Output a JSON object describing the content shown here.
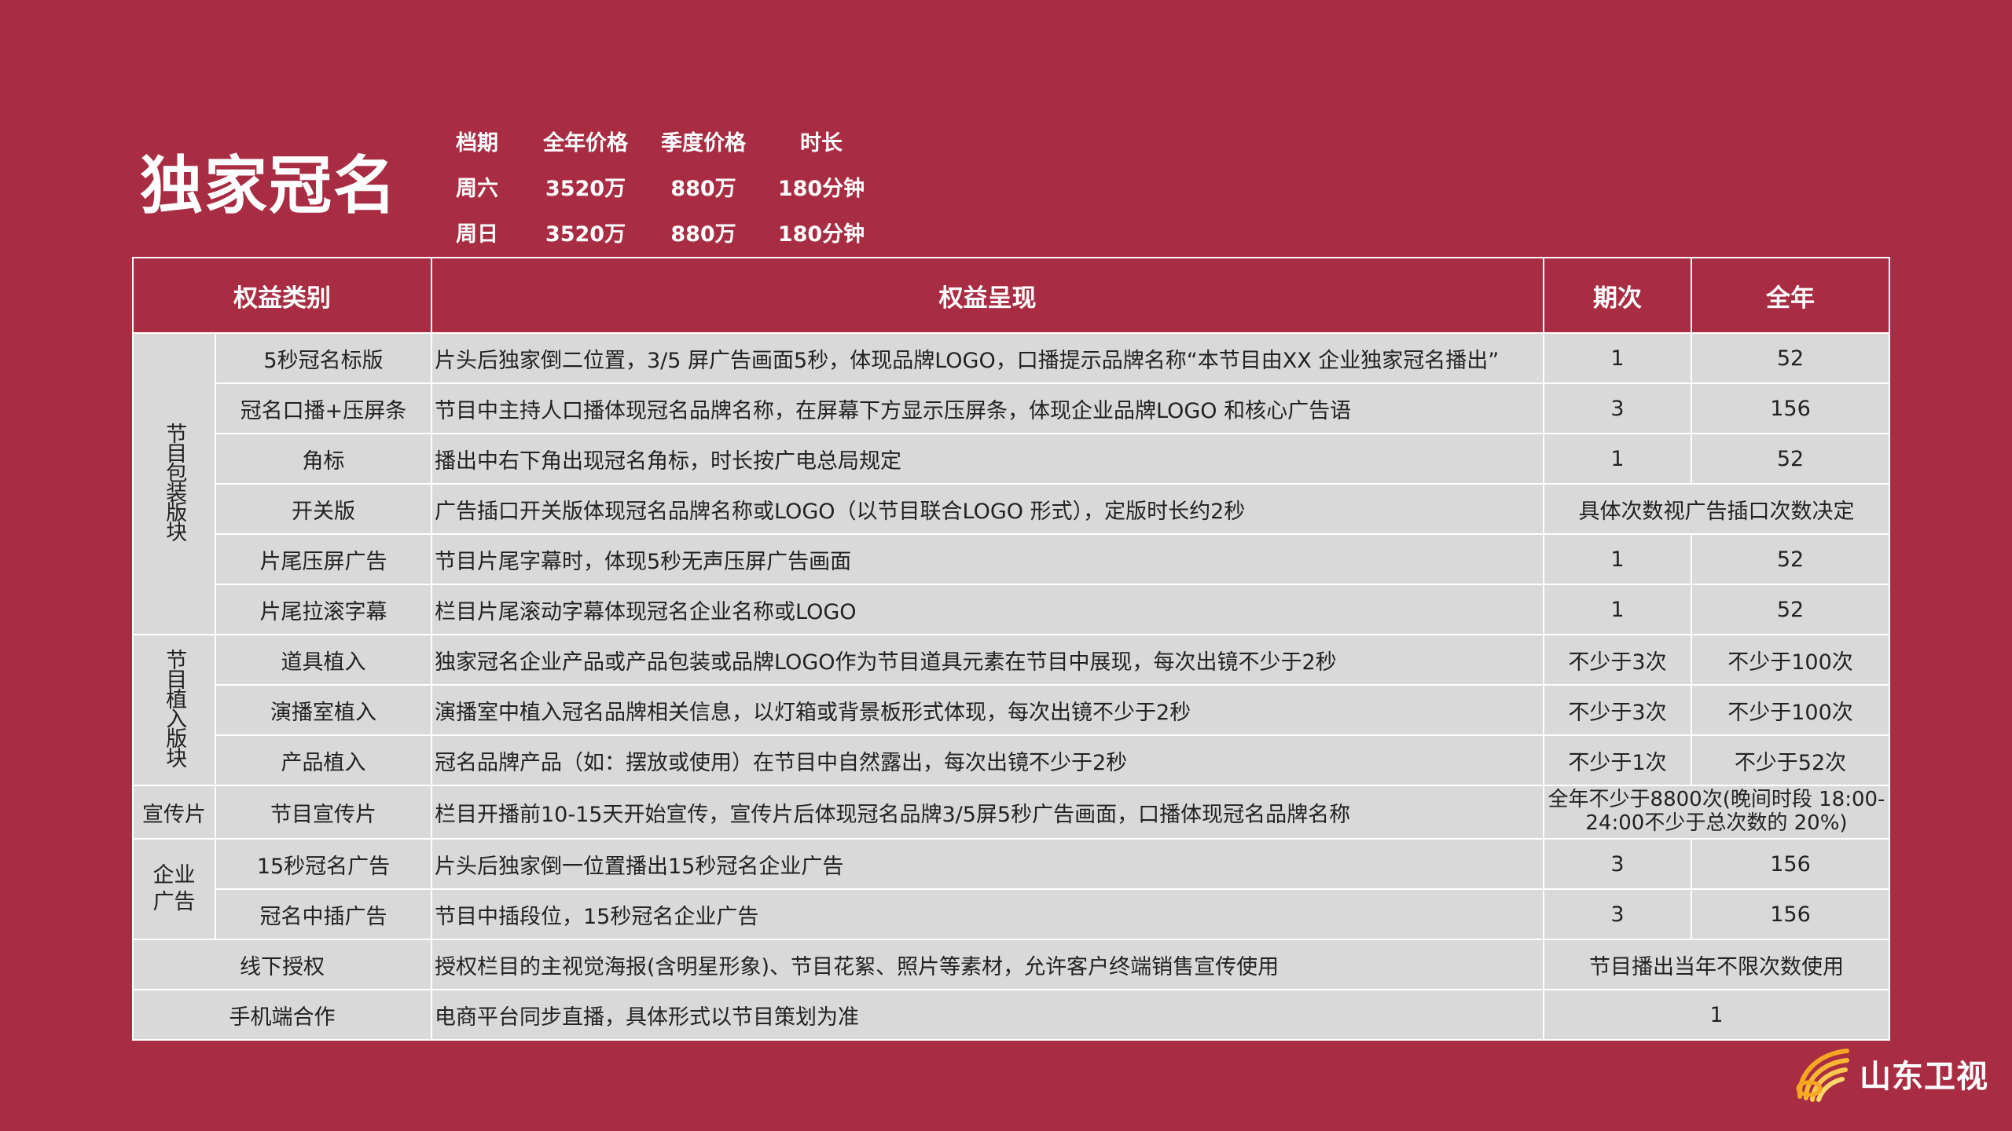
{
  "title": "独家冠名",
  "price_table": {
    "headers": [
      "档期",
      "全年价格",
      "季度价格",
      "时长"
    ],
    "rows": [
      [
        "周六",
        "3520万",
        "880万",
        "180分钟"
      ],
      [
        "周日",
        "3520万",
        "880万",
        "180分钟"
      ]
    ]
  },
  "benefits": {
    "headers": [
      "权益类别",
      "权益呈现",
      "期次",
      "全年"
    ],
    "groups": {
      "packaging": "节目包装版块",
      "placement": "节目植入版块",
      "promo": "宣传片",
      "ads": "企业广告",
      "offline": "线下授权",
      "mobile": "手机端合作"
    },
    "rows": [
      {
        "item": "5秒冠名标版",
        "desc": "片头后独家倒二位置，3/5 屏广告画面5秒，体现品牌LOGO，口播提示品牌名称“本节目由XX 企业独家冠名播出”",
        "period": "1",
        "year": "52"
      },
      {
        "item": "冠名口播+压屏条",
        "desc": "节目中主持人口播体现冠名品牌名称，在屏幕下方显示压屏条，体现企业品牌LOGO 和核心广告语",
        "period": "3",
        "year": "156"
      },
      {
        "item": "角标",
        "desc": "播出中右下角出现冠名角标，时长按广电总局规定",
        "period": "1",
        "year": "52"
      },
      {
        "item": "开关版",
        "desc": "广告插口开关版体现冠名品牌名称或LOGO（以节目联合LOGO 形式），定版时长约2秒",
        "merged": "具体次数视广告插口次数决定"
      },
      {
        "item": "片尾压屏广告",
        "desc": "节目片尾字幕时，体现5秒无声压屏广告画面",
        "period": "1",
        "year": "52"
      },
      {
        "item": "片尾拉滚字幕",
        "desc": "栏目片尾滚动字幕体现冠名企业名称或LOGO",
        "period": "1",
        "year": "52"
      },
      {
        "item": "道具植入",
        "desc": "独家冠名企业产品或产品包装或品牌LOGO作为节目道具元素在节目中展现，每次出镜不少于2秒",
        "period": "不少于3次",
        "year": "不少于100次"
      },
      {
        "item": "演播室植入",
        "desc": "演播室中植入冠名品牌相关信息，以灯箱或背景板形式体现，每次出镜不少于2秒",
        "period": "不少于3次",
        "year": "不少于100次"
      },
      {
        "item": "产品植入",
        "desc": "冠名品牌产品（如：摆放或使用）在节目中自然露出，每次出镜不少于2秒",
        "period": "不少于1次",
        "year": "不少于52次"
      },
      {
        "item": "节目宣传片",
        "desc": "栏目开播前10-15天开始宣传，宣传片后体现冠名品牌3/5屏5秒广告画面，口播体现冠名品牌名称",
        "merged": "全年不少于8800次(晚间时段 18:00-24:00不少于总次数的 20%)"
      },
      {
        "item": "15秒冠名广告",
        "desc": "片头后独家倒一位置播出15秒冠名企业广告",
        "period": "3",
        "year": "156"
      },
      {
        "item": "冠名中插广告",
        "desc": "节目中插段位，15秒冠名企业广告",
        "period": "3",
        "year": "156"
      },
      {
        "desc": "授权栏目的主视觉海报(含明星形象)、节目花絮、照片等素材，允许客户终端销售宣传使用",
        "merged": "节目播出当年不限次数使用"
      },
      {
        "desc": "电商平台同步直播，具体形式以节目策划为准",
        "merged": "1"
      }
    ]
  },
  "logo": {
    "text": "山东卫视",
    "icon": "sun-rays-icon",
    "color": "#f5a623"
  },
  "colors": {
    "background": "#a92d42",
    "cell": "#d9d9d9"
  }
}
